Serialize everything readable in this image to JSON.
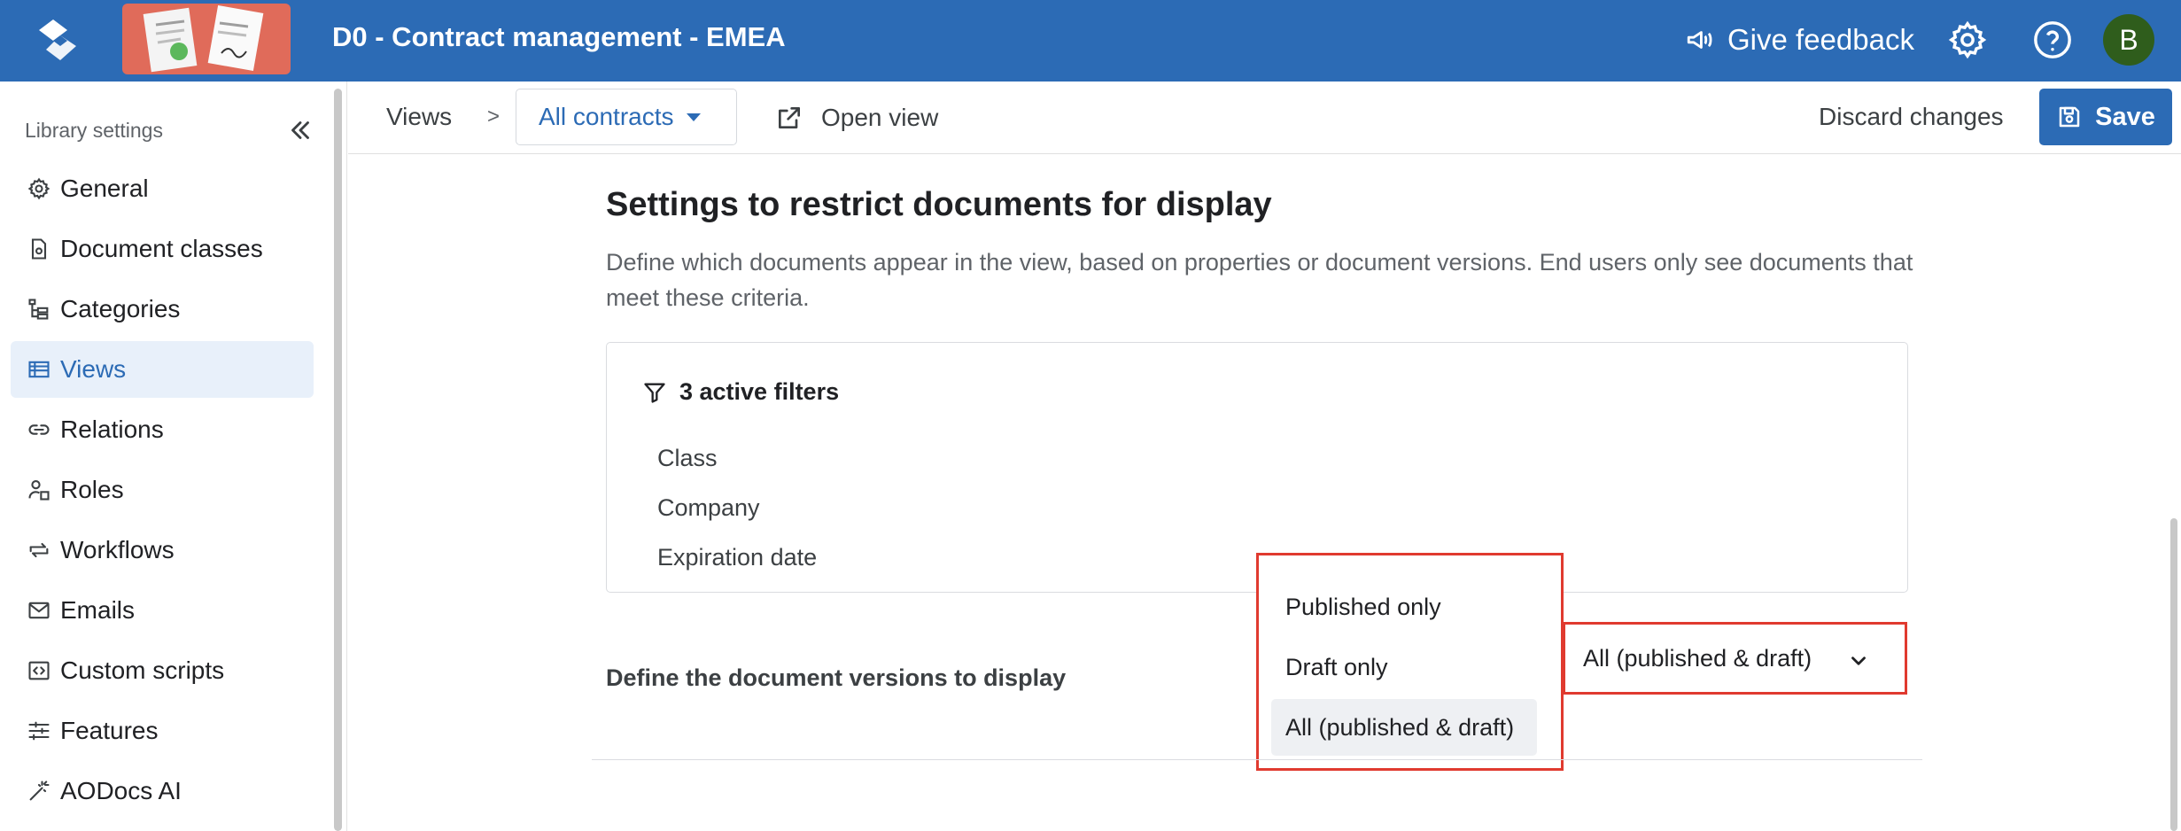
{
  "header": {
    "title": "D0 - Contract management - EMEA",
    "feedback_label": "Give feedback",
    "avatar_initial": "B"
  },
  "sidebar": {
    "heading": "Library settings",
    "items": [
      {
        "label": "General",
        "icon": "gear-icon"
      },
      {
        "label": "Document classes",
        "icon": "document-class-icon"
      },
      {
        "label": "Categories",
        "icon": "categories-icon"
      },
      {
        "label": "Views",
        "icon": "views-icon",
        "active": true
      },
      {
        "label": "Relations",
        "icon": "link-icon"
      },
      {
        "label": "Roles",
        "icon": "roles-icon"
      },
      {
        "label": "Workflows",
        "icon": "workflow-icon"
      },
      {
        "label": "Emails",
        "icon": "mail-icon"
      },
      {
        "label": "Custom scripts",
        "icon": "code-icon"
      },
      {
        "label": "Features",
        "icon": "sliders-icon"
      },
      {
        "label": "AODocs AI",
        "icon": "magic-wand-icon"
      }
    ]
  },
  "toolbar": {
    "breadcrumb_root": "Views",
    "breadcrumb_separator": ">",
    "current_view": "All contracts",
    "open_view_label": "Open view",
    "discard_label": "Discard changes",
    "save_label": "Save"
  },
  "main": {
    "section_title": "Settings to restrict documents for display",
    "section_description": "Define which documents appear in the view, based on properties or document versions. End users only see documents that meet these criteria.",
    "filters": {
      "header": "3 active filters",
      "items": [
        "Class",
        "Company",
        "Expiration date"
      ]
    },
    "versions": {
      "label": "Define the document versions to display",
      "selected": "All (published & draft)",
      "options": [
        "Published only",
        "Draft only",
        "All (published & draft)"
      ]
    }
  },
  "colors": {
    "brand_blue": "#2c6bb5",
    "highlight_red": "#e03a2f",
    "active_nav_bg": "#e8f0fa",
    "avatar_green": "#2f5d1c"
  }
}
